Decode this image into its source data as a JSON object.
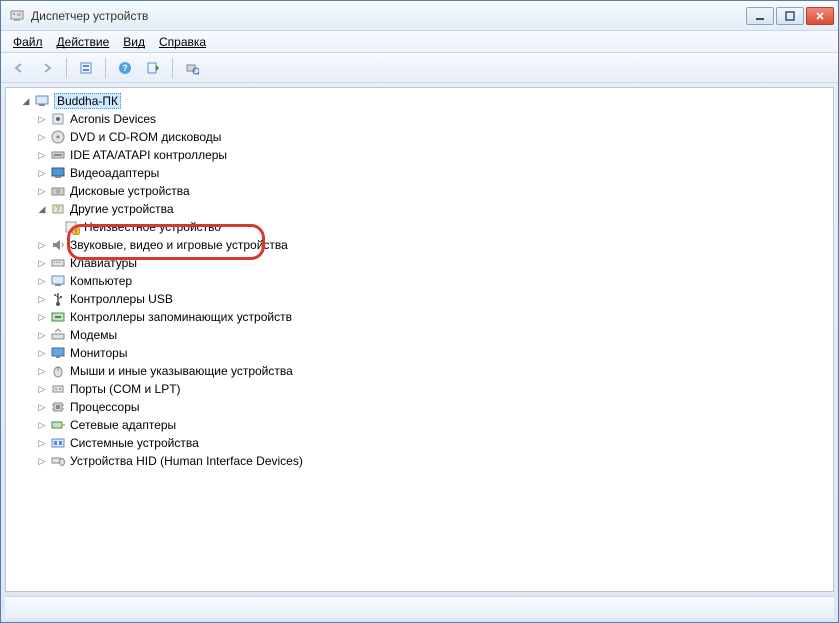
{
  "window": {
    "title": "Диспетчер устройств"
  },
  "menu": {
    "file": "Файл",
    "action": "Действие",
    "view": "Вид",
    "help": "Справка"
  },
  "tree": {
    "root": "Buddha-ПК",
    "items": [
      {
        "label": "Acronis Devices"
      },
      {
        "label": "DVD и CD-ROM дисководы"
      },
      {
        "label": "IDE ATA/ATAPI контроллеры"
      },
      {
        "label": "Видеоадаптеры"
      },
      {
        "label": "Дисковые устройства"
      },
      {
        "label": "Другие устройства",
        "expanded": true,
        "children": [
          {
            "label": "Неизвестное устройство",
            "warn": true
          }
        ]
      },
      {
        "label": "Звуковые, видео и игровые устройства"
      },
      {
        "label": "Клавиатуры"
      },
      {
        "label": "Компьютер"
      },
      {
        "label": "Контроллеры USB"
      },
      {
        "label": "Контроллеры запоминающих устройств"
      },
      {
        "label": "Модемы"
      },
      {
        "label": "Мониторы"
      },
      {
        "label": "Мыши и иные указывающие устройства"
      },
      {
        "label": "Порты (COM и LPT)"
      },
      {
        "label": "Процессоры"
      },
      {
        "label": "Сетевые адаптеры"
      },
      {
        "label": "Системные устройства"
      },
      {
        "label": "Устройства HID (Human Interface Devices)"
      }
    ]
  }
}
